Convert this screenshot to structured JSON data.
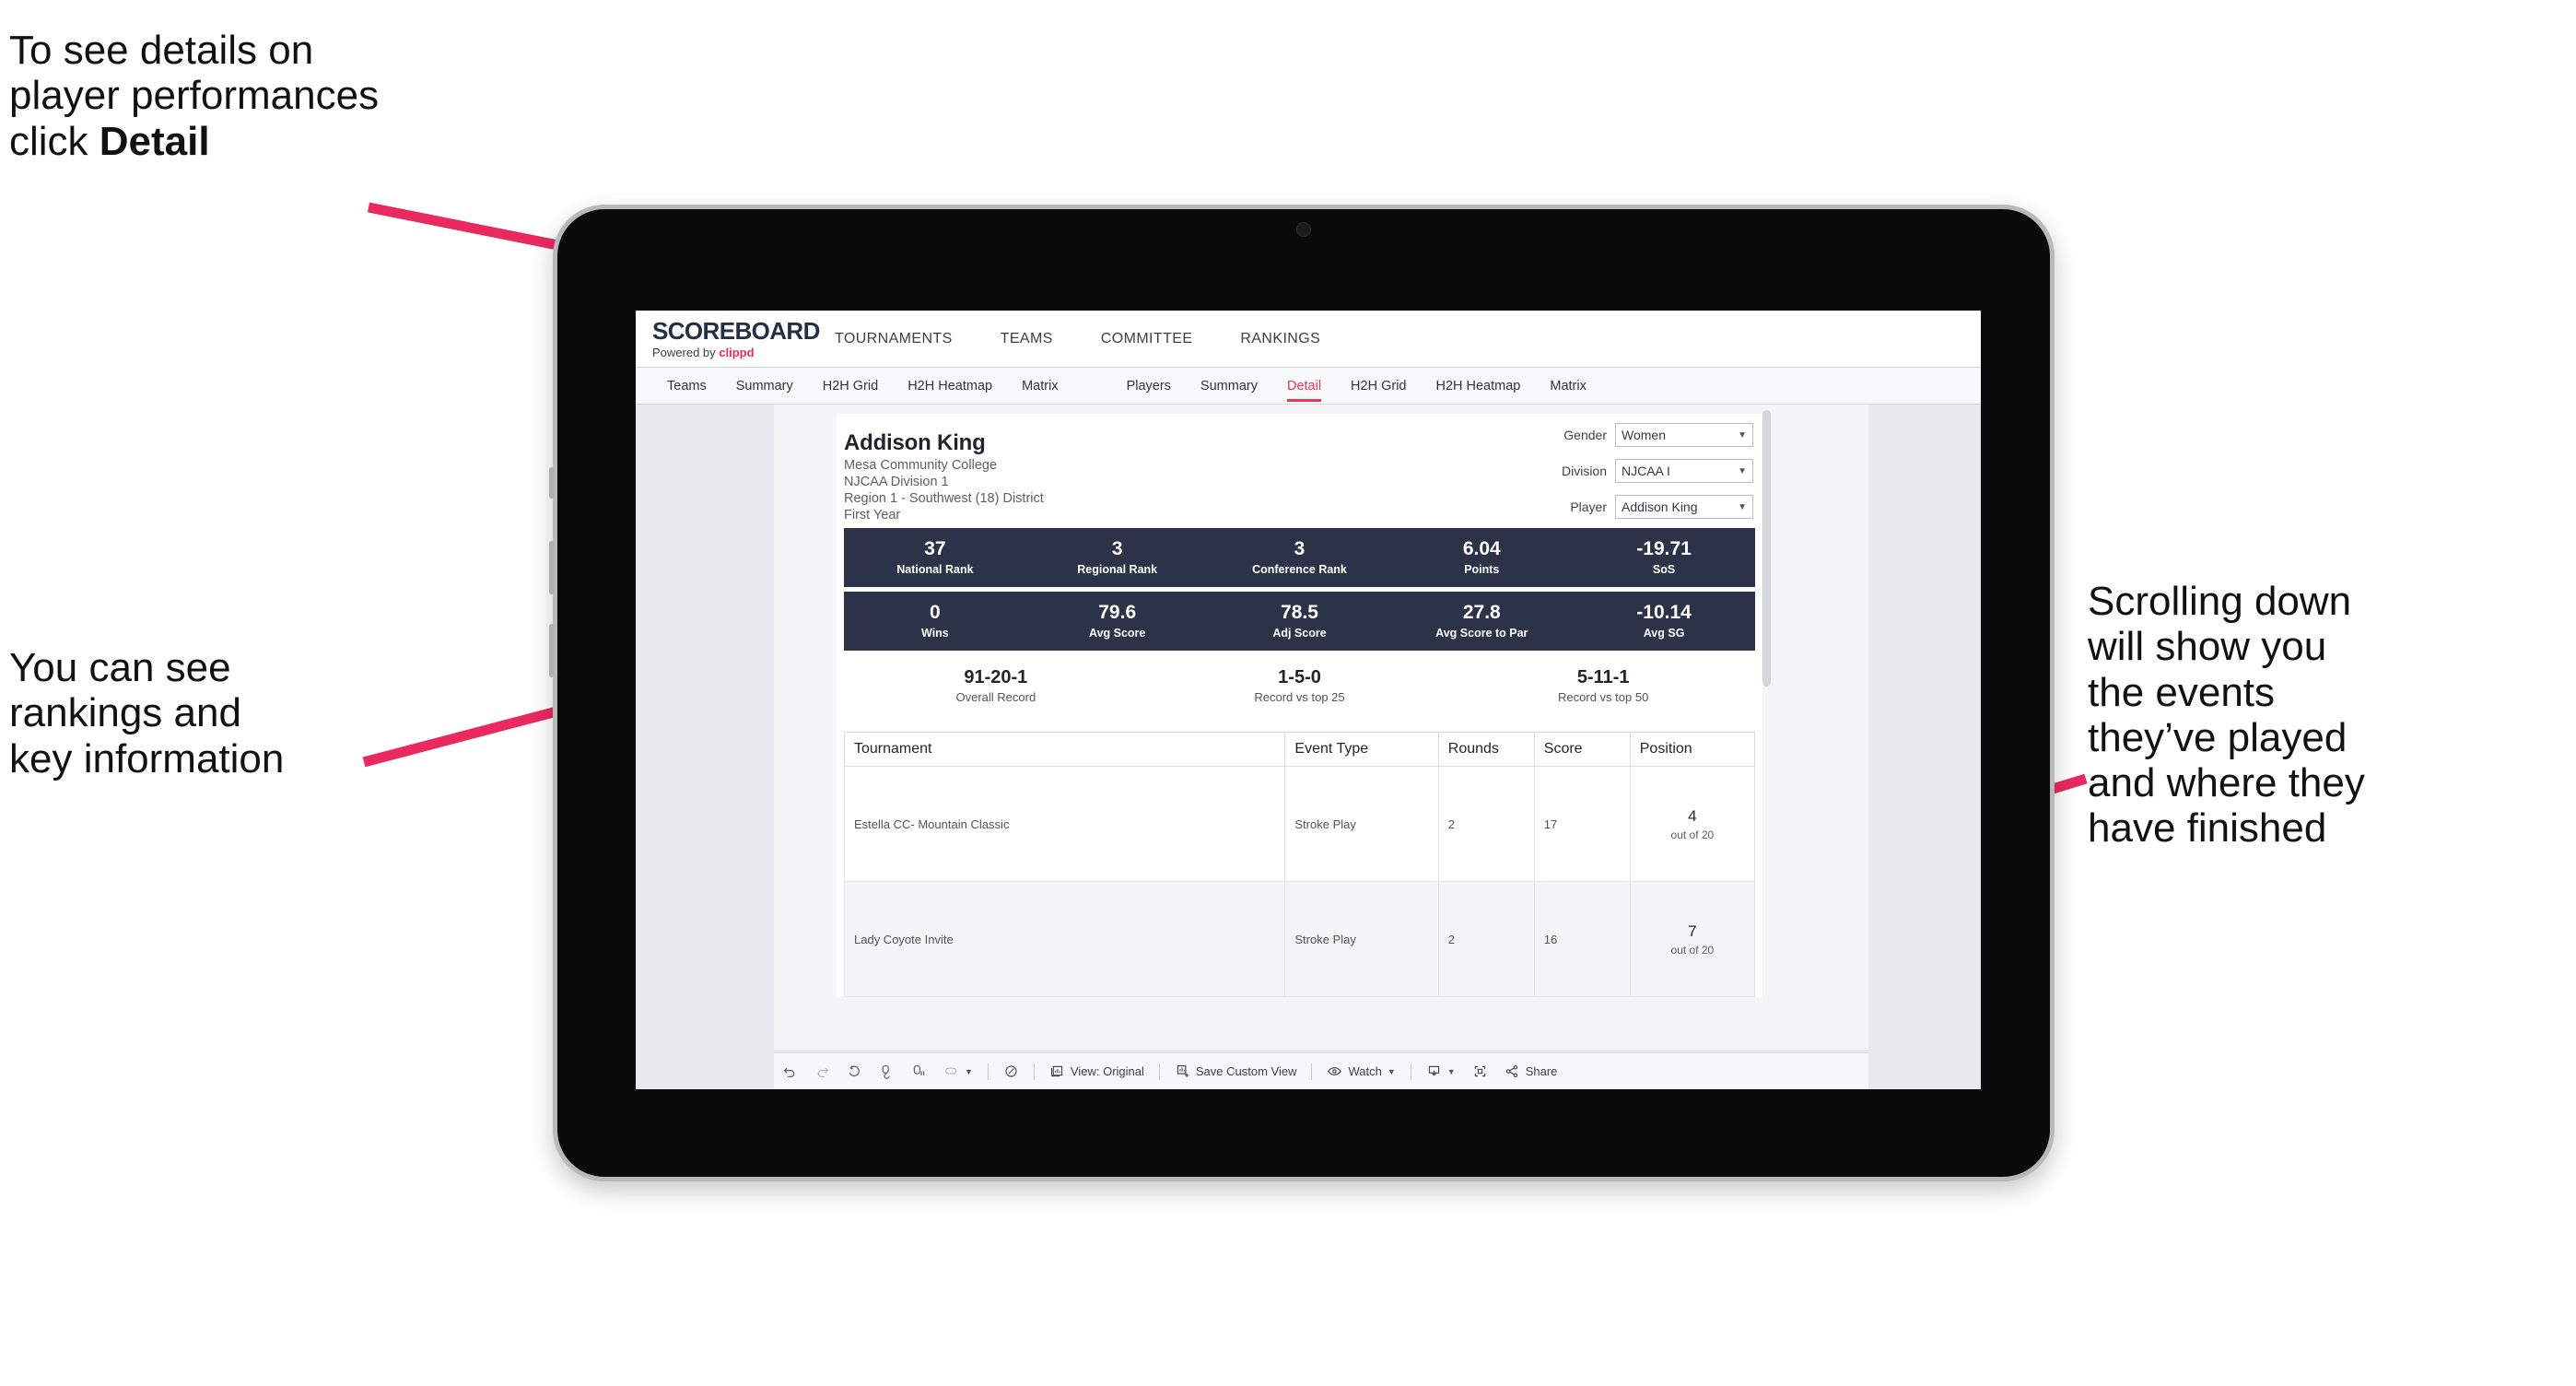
{
  "annotations": {
    "detail": {
      "text_1": "To see details on\nplayer performances\nclick ",
      "bold": "Detail"
    },
    "rankings": {
      "text": "You can see\nrankings and\nkey information"
    },
    "scroll": {
      "text": "Scrolling down\nwill show you\nthe events\nthey’ve played\nand where they\nhave finished"
    },
    "arrow_color": "#ea2a5f"
  },
  "app": {
    "brand": {
      "title": "SCOREBOARD",
      "powered_prefix": "Powered by ",
      "powered_name": "clippd"
    },
    "topnav": [
      {
        "label": "TOURNAMENTS"
      },
      {
        "label": "TEAMS"
      },
      {
        "label": "COMMITTEE"
      },
      {
        "label": "RANKINGS"
      }
    ],
    "subnav_left": [
      {
        "label": "Teams",
        "active": false
      },
      {
        "label": "Summary",
        "active": false
      },
      {
        "label": "H2H Grid",
        "active": false
      },
      {
        "label": "H2H Heatmap",
        "active": false
      },
      {
        "label": "Matrix",
        "active": false
      }
    ],
    "subnav_right": [
      {
        "label": "Players",
        "active": false
      },
      {
        "label": "Summary",
        "active": false
      },
      {
        "label": "Detail",
        "active": true
      },
      {
        "label": "H2H Grid",
        "active": false
      },
      {
        "label": "H2H Heatmap",
        "active": false
      },
      {
        "label": "Matrix",
        "active": false
      }
    ]
  },
  "player": {
    "name": "Addison King",
    "school": "Mesa Community College",
    "division": "NJCAA Division 1",
    "region": "Region 1 - Southwest (18) District",
    "year": "First Year"
  },
  "filters": [
    {
      "label": "Gender",
      "value": "Women"
    },
    {
      "label": "Division",
      "value": "NJCAA I"
    },
    {
      "label": "Player",
      "value": "Addison King"
    }
  ],
  "stats_row_1": [
    {
      "value": "37",
      "label": "National Rank"
    },
    {
      "value": "3",
      "label": "Regional Rank"
    },
    {
      "value": "3",
      "label": "Conference Rank"
    },
    {
      "value": "6.04",
      "label": "Points"
    },
    {
      "value": "-19.71",
      "label": "SoS"
    }
  ],
  "stats_row_2": [
    {
      "value": "0",
      "label": "Wins"
    },
    {
      "value": "79.6",
      "label": "Avg Score"
    },
    {
      "value": "78.5",
      "label": "Adj Score"
    },
    {
      "value": "27.8",
      "label": "Avg Score to Par"
    },
    {
      "value": "-10.14",
      "label": "Avg SG"
    }
  ],
  "records": [
    {
      "value": "91-20-1",
      "label": "Overall Record"
    },
    {
      "value": "1-5-0",
      "label": "Record vs top 25"
    },
    {
      "value": "5-11-1",
      "label": "Record vs top 50"
    }
  ],
  "events_table": {
    "columns": [
      "Tournament",
      "Event Type",
      "Rounds",
      "Score",
      "Position"
    ],
    "rows": [
      {
        "tournament": "Estella CC- Mountain Classic",
        "event_type": "Stroke Play",
        "rounds": "2",
        "score": "17",
        "position": "4",
        "position_sub": "out of 20"
      },
      {
        "tournament": "Lady Coyote Invite",
        "event_type": "Stroke Play",
        "rounds": "2",
        "score": "16",
        "position": "7",
        "position_sub": "out of 20"
      }
    ]
  },
  "toolbar": {
    "view_label": "View: Original",
    "save_label": "Save Custom View",
    "watch_label": "Watch",
    "share_label": "Share"
  },
  "colors": {
    "accent": "#e8365d",
    "navy": "#2c3348",
    "arrow": "#ea2a5f"
  }
}
